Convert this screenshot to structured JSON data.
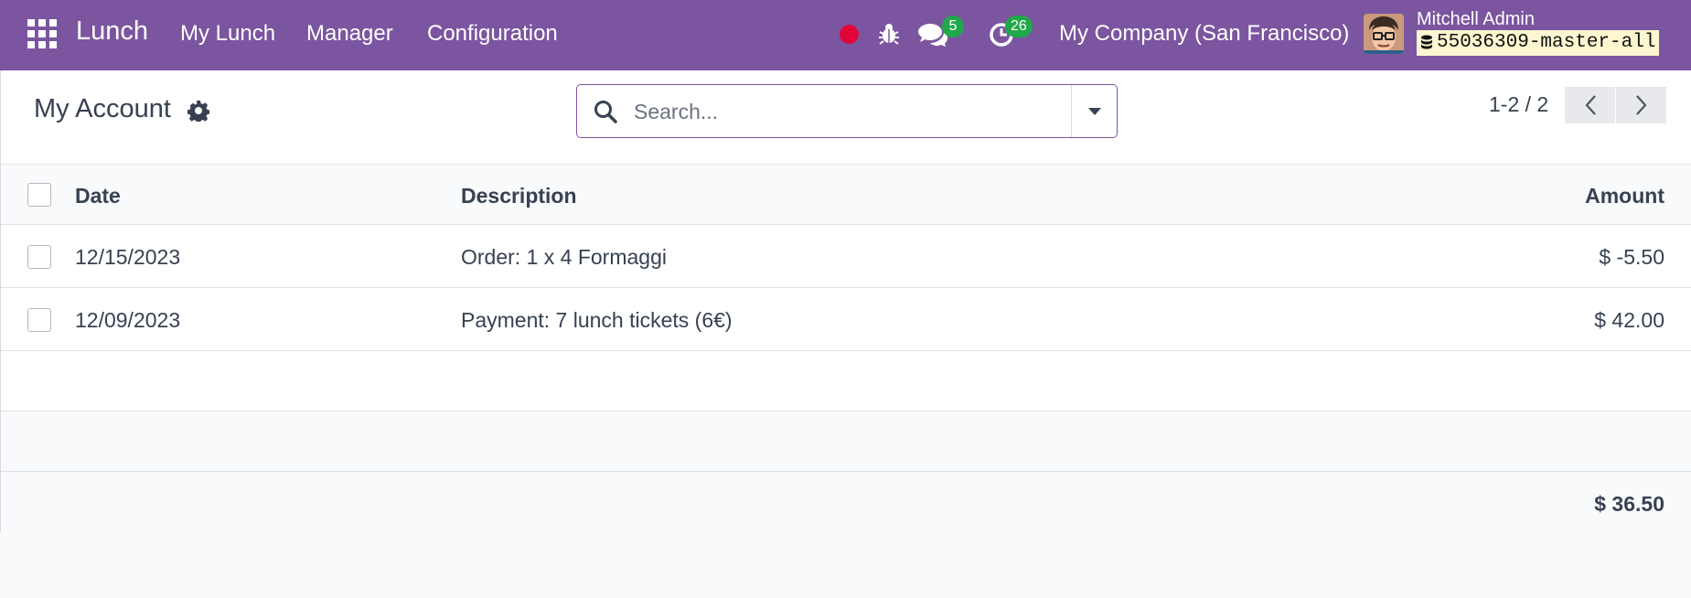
{
  "navbar": {
    "app_name": "Lunch",
    "menu": [
      "My Lunch",
      "Manager",
      "Configuration"
    ],
    "messages_count": "5",
    "activities_count": "26",
    "company": "My Company (San Francisco)",
    "user_name": "Mitchell Admin",
    "database": "55036309-master-all",
    "colors": {
      "bar": "#7b559f",
      "badge": "#20a94a",
      "recording_dot": "#e0063b"
    }
  },
  "control_panel": {
    "title": "My Account",
    "search_placeholder": "Search...",
    "pager": "1-2 / 2"
  },
  "list": {
    "columns": [
      "Date",
      "Description",
      "Amount"
    ],
    "rows": [
      {
        "date": "12/15/2023",
        "description": "Order: 1 x 4 Formaggi",
        "amount": "$ -5.50"
      },
      {
        "date": "12/09/2023",
        "description": "Payment: 7 lunch tickets (6€)",
        "amount": "$ 42.00"
      }
    ],
    "total": "$ 36.50"
  }
}
